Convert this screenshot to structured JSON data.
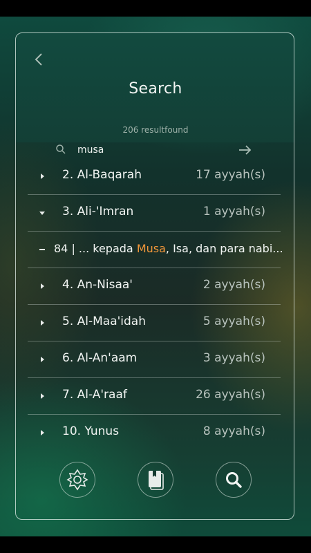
{
  "header": {
    "title": "Search",
    "results_text": "206 resultfound"
  },
  "search": {
    "value": "musa"
  },
  "list": [
    {
      "name": "2. Al-Baqarah",
      "count": "17 ayyah(s)",
      "expanded": false
    },
    {
      "name": "3. Ali-'Imran",
      "count": "1 ayyah(s)",
      "expanded": true
    },
    {
      "name": "4. An-Nisaa'",
      "count": "2 ayyah(s)",
      "expanded": false
    },
    {
      "name": "5. Al-Maa'idah",
      "count": "5 ayyah(s)",
      "expanded": false
    },
    {
      "name": "6. Al-An'aam",
      "count": "3 ayyah(s)",
      "expanded": false
    },
    {
      "name": "7. Al-A'raaf",
      "count": "26 ayyah(s)",
      "expanded": false
    },
    {
      "name": "10. Yunus",
      "count": "8 ayyah(s)",
      "expanded": false
    }
  ],
  "verse": {
    "prefix": "84 | ... kepada ",
    "highlight": "Musa",
    "suffix": ", Isa, dan para nabi..."
  },
  "icons": {
    "back": "chevron-left-icon",
    "search": "search-icon",
    "go": "arrow-right-icon",
    "nav": [
      "settings-star-icon",
      "book-icon",
      "search-icon"
    ]
  },
  "colors": {
    "highlight": "#f0963a",
    "text": "#f1f4f2",
    "muted": "#b9c4bf"
  }
}
